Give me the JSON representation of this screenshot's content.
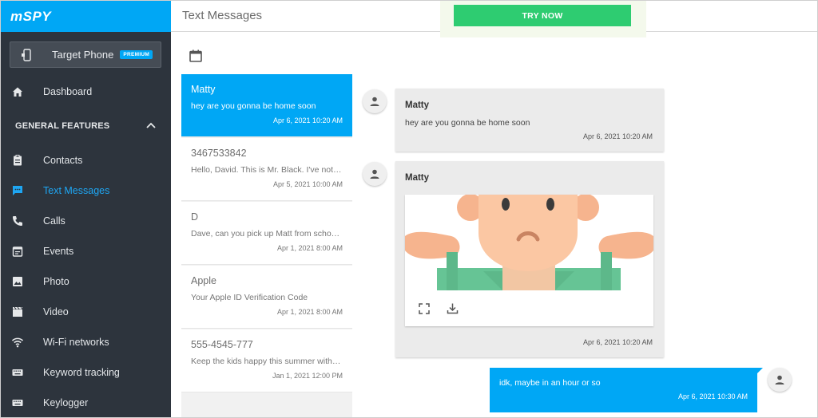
{
  "sidebar": {
    "logo": "mSPY",
    "target_phone": {
      "label": "Target Phone",
      "badge": "PREMIUM"
    },
    "dashboard": "Dashboard",
    "section_title": "GENERAL FEATURES",
    "items": [
      {
        "label": "Contacts",
        "icon": "clipboard-icon"
      },
      {
        "label": "Text Messages",
        "icon": "chat-icon",
        "active": true
      },
      {
        "label": "Calls",
        "icon": "phone-icon"
      },
      {
        "label": "Events",
        "icon": "calendar-list-icon"
      },
      {
        "label": "Photo",
        "icon": "image-icon"
      },
      {
        "label": "Video",
        "icon": "film-icon"
      },
      {
        "label": "Wi-Fi networks",
        "icon": "wifi-icon"
      },
      {
        "label": "Keyword tracking",
        "icon": "keyboard-icon"
      },
      {
        "label": "Keylogger",
        "icon": "keyboard-icon"
      }
    ]
  },
  "header": {
    "title": "Text Messages",
    "try_now": "TRY NOW"
  },
  "threads": [
    {
      "name": "Matty",
      "snippet": "hey are you gonna be home soon",
      "time": "Apr 6, 2021 10:20 AM",
      "selected": true
    },
    {
      "name": "3467533842",
      "snippet": "Hello, David. This is Mr. Black. I've noticed",
      "time": "Apr 5, 2021 10:00 AM"
    },
    {
      "name": "D",
      "snippet": "Dave, can you pick up Matt from school today",
      "time": "Apr 1, 2021 8:00 AM"
    },
    {
      "name": "Apple",
      "snippet": "Your Apple ID Verification Code",
      "time": "Apr 1, 2021 8:00 AM"
    },
    {
      "name": "555-4545-777",
      "snippet": "Keep the kids happy this summer with our offers",
      "time": "Jan 1, 2021 12:00 PM"
    }
  ],
  "conversation": {
    "messages": [
      {
        "sender": "Matty",
        "text": "hey are you gonna be home soon",
        "time": "Apr 6, 2021 10:20 AM"
      },
      {
        "sender": "Matty",
        "time": "Apr 6, 2021 10:20 AM"
      }
    ],
    "outgoing": {
      "text": "idk, maybe in an hour or so",
      "time": "Apr 6, 2021 10:30 AM"
    }
  },
  "colors": {
    "accent": "#00a7f5",
    "sidebar_bg": "#2d343d",
    "try_now": "#2ecc71",
    "bubble_bg": "#ebebeb"
  }
}
